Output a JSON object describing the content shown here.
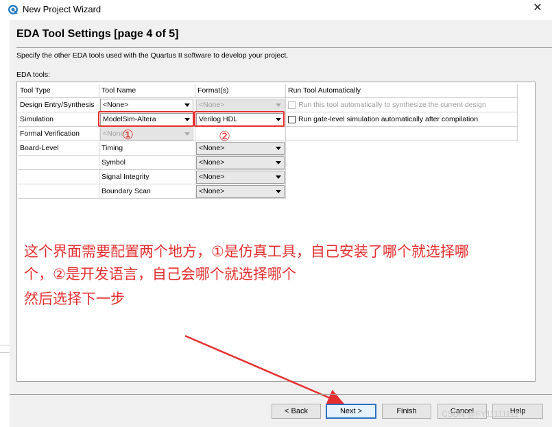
{
  "window": {
    "title": "New Project Wizard",
    "icon": "quartus-app-icon",
    "close_glyph": "✕"
  },
  "page": {
    "title": "EDA Tool Settings [page 4 of 5]",
    "subtitle": "Specify the other EDA tools used with the Quartus II software to develop your project.",
    "eda_label": "EDA tools:"
  },
  "table": {
    "headers": [
      "Tool Type",
      "Tool Name",
      "Format(s)",
      "Run Tool Automatically"
    ],
    "rows": [
      {
        "type": "Design Entry/Synthesis",
        "name": "<None>",
        "format": "<None>",
        "run": "Run this tool automatically to synthesize the current design"
      },
      {
        "type": "Simulation",
        "name": "ModelSim-Altera",
        "format": "Verilog HDL",
        "run": "Run gate-level simulation automatically after compilation"
      },
      {
        "type": "Formal Verification",
        "name": "<None>",
        "format": "",
        "run": ""
      },
      {
        "type": "Board-Level",
        "name": "Timing",
        "format": "<None>",
        "run": ""
      },
      {
        "type": "",
        "name": "Symbol",
        "format": "<None>",
        "run": ""
      },
      {
        "type": "",
        "name": "Signal Integrity",
        "format": "<None>",
        "run": ""
      },
      {
        "type": "",
        "name": "Boundary Scan",
        "format": "<None>",
        "run": ""
      }
    ]
  },
  "annotations": {
    "marker1": "①",
    "marker2": "②",
    "line1": "这个界面需要配置两个地方，①是仿真工具，自己安装了哪个就选择哪",
    "line2": "个，②是开发语言，自己会哪个就选择哪个",
    "line3": "然后选择下一步",
    "color": "#e62e2e"
  },
  "buttons": {
    "back": "< Back",
    "next": "Next >",
    "finish": "Finish",
    "cancel": "Cancel",
    "help": "Help"
  },
  "watermark": "CSDN @FY11111111"
}
